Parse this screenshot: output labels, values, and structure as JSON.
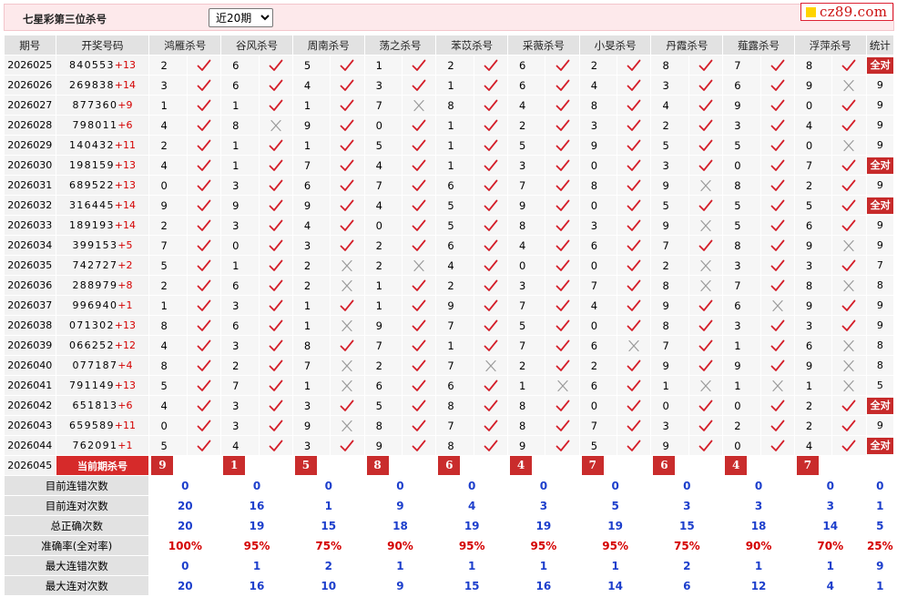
{
  "header": {
    "title": "七星彩第三位杀号",
    "period_select": "近20期",
    "logo_text": "cz89.com"
  },
  "columns": [
    "期号",
    "开奖号码",
    "鸿雁杀号",
    "谷风杀号",
    "周南杀号",
    "荡之杀号",
    "苯苡杀号",
    "采薇杀号",
    "小旻杀号",
    "丹霞杀号",
    "薤露杀号",
    "浮萍杀号",
    "统计"
  ],
  "rows": [
    {
      "period": "2026025",
      "digits": "840553",
      "extra": "+13",
      "kills": [
        "2",
        "6",
        "5",
        "1",
        "2",
        "6",
        "2",
        "8",
        "7",
        "8"
      ],
      "marks": [
        1,
        1,
        1,
        1,
        1,
        1,
        1,
        1,
        1,
        1
      ],
      "stat": "全对"
    },
    {
      "period": "2026026",
      "digits": "269838",
      "extra": "+14",
      "kills": [
        "3",
        "6",
        "4",
        "3",
        "1",
        "6",
        "4",
        "3",
        "6",
        "9"
      ],
      "marks": [
        1,
        1,
        1,
        1,
        1,
        1,
        1,
        1,
        1,
        0
      ],
      "stat": "9"
    },
    {
      "period": "2026027",
      "digits": "877360",
      "extra": "+9",
      "kills": [
        "1",
        "1",
        "1",
        "7",
        "8",
        "4",
        "8",
        "4",
        "9",
        "0"
      ],
      "marks": [
        1,
        1,
        1,
        0,
        1,
        1,
        1,
        1,
        1,
        1
      ],
      "stat": "9"
    },
    {
      "period": "2026028",
      "digits": "798011",
      "extra": "+6",
      "kills": [
        "4",
        "8",
        "9",
        "0",
        "1",
        "2",
        "3",
        "2",
        "3",
        "4"
      ],
      "marks": [
        1,
        0,
        1,
        1,
        1,
        1,
        1,
        1,
        1,
        1
      ],
      "stat": "9"
    },
    {
      "period": "2026029",
      "digits": "140432",
      "extra": "+11",
      "kills": [
        "2",
        "1",
        "1",
        "5",
        "1",
        "5",
        "9",
        "5",
        "5",
        "0"
      ],
      "marks": [
        1,
        1,
        1,
        1,
        1,
        1,
        1,
        1,
        1,
        0
      ],
      "stat": "9"
    },
    {
      "period": "2026030",
      "digits": "198159",
      "extra": "+13",
      "kills": [
        "4",
        "1",
        "7",
        "4",
        "1",
        "3",
        "0",
        "3",
        "0",
        "7"
      ],
      "marks": [
        1,
        1,
        1,
        1,
        1,
        1,
        1,
        1,
        1,
        1
      ],
      "stat": "全对"
    },
    {
      "period": "2026031",
      "digits": "689522",
      "extra": "+13",
      "kills": [
        "0",
        "3",
        "6",
        "7",
        "6",
        "7",
        "8",
        "9",
        "8",
        "2"
      ],
      "marks": [
        1,
        1,
        1,
        1,
        1,
        1,
        1,
        0,
        1,
        1
      ],
      "stat": "9"
    },
    {
      "period": "2026032",
      "digits": "316445",
      "extra": "+14",
      "kills": [
        "9",
        "9",
        "9",
        "4",
        "5",
        "9",
        "0",
        "5",
        "5",
        "5"
      ],
      "marks": [
        1,
        1,
        1,
        1,
        1,
        1,
        1,
        1,
        1,
        1
      ],
      "stat": "全对"
    },
    {
      "period": "2026033",
      "digits": "189193",
      "extra": "+14",
      "kills": [
        "2",
        "3",
        "4",
        "0",
        "5",
        "8",
        "3",
        "9",
        "5",
        "6"
      ],
      "marks": [
        1,
        1,
        1,
        1,
        1,
        1,
        1,
        0,
        1,
        1
      ],
      "stat": "9"
    },
    {
      "period": "2026034",
      "digits": "399153",
      "extra": "+5",
      "kills": [
        "7",
        "0",
        "3",
        "2",
        "6",
        "4",
        "6",
        "7",
        "8",
        "9"
      ],
      "marks": [
        1,
        1,
        1,
        1,
        1,
        1,
        1,
        1,
        1,
        0
      ],
      "stat": "9"
    },
    {
      "period": "2026035",
      "digits": "742727",
      "extra": "+2",
      "kills": [
        "5",
        "1",
        "2",
        "2",
        "4",
        "0",
        "0",
        "2",
        "3",
        "3"
      ],
      "marks": [
        1,
        1,
        0,
        0,
        1,
        1,
        1,
        0,
        1,
        1
      ],
      "stat": "7"
    },
    {
      "period": "2026036",
      "digits": "288979",
      "extra": "+8",
      "kills": [
        "2",
        "6",
        "2",
        "1",
        "2",
        "3",
        "7",
        "8",
        "7",
        "8"
      ],
      "marks": [
        1,
        1,
        0,
        1,
        1,
        1,
        1,
        0,
        1,
        0
      ],
      "stat": "8"
    },
    {
      "period": "2026037",
      "digits": "996940",
      "extra": "+1",
      "kills": [
        "1",
        "3",
        "1",
        "1",
        "9",
        "7",
        "4",
        "9",
        "6",
        "9"
      ],
      "marks": [
        1,
        1,
        1,
        1,
        1,
        1,
        1,
        1,
        0,
        1
      ],
      "stat": "9"
    },
    {
      "period": "2026038",
      "digits": "071302",
      "extra": "+13",
      "kills": [
        "8",
        "6",
        "1",
        "9",
        "7",
        "5",
        "0",
        "8",
        "3",
        "3"
      ],
      "marks": [
        1,
        1,
        0,
        1,
        1,
        1,
        1,
        1,
        1,
        1
      ],
      "stat": "9"
    },
    {
      "period": "2026039",
      "digits": "066252",
      "extra": "+12",
      "kills": [
        "4",
        "3",
        "8",
        "7",
        "1",
        "7",
        "6",
        "7",
        "1",
        "6"
      ],
      "marks": [
        1,
        1,
        1,
        1,
        1,
        1,
        0,
        1,
        1,
        0
      ],
      "stat": "8"
    },
    {
      "period": "2026040",
      "digits": "077187",
      "extra": "+4",
      "kills": [
        "8",
        "2",
        "7",
        "2",
        "7",
        "2",
        "2",
        "9",
        "9",
        "9"
      ],
      "marks": [
        1,
        1,
        0,
        1,
        0,
        1,
        1,
        1,
        1,
        0
      ],
      "stat": "8"
    },
    {
      "period": "2026041",
      "digits": "791149",
      "extra": "+13",
      "kills": [
        "5",
        "7",
        "1",
        "6",
        "6",
        "1",
        "6",
        "1",
        "1",
        "1"
      ],
      "marks": [
        1,
        1,
        0,
        1,
        1,
        0,
        1,
        0,
        0,
        0
      ],
      "stat": "5"
    },
    {
      "period": "2026042",
      "digits": "651813",
      "extra": "+6",
      "kills": [
        "4",
        "3",
        "3",
        "5",
        "8",
        "8",
        "0",
        "0",
        "0",
        "2"
      ],
      "marks": [
        1,
        1,
        1,
        1,
        1,
        1,
        1,
        1,
        1,
        1
      ],
      "stat": "全对"
    },
    {
      "period": "2026043",
      "digits": "659589",
      "extra": "+11",
      "kills": [
        "0",
        "3",
        "9",
        "8",
        "7",
        "8",
        "7",
        "3",
        "2",
        "2"
      ],
      "marks": [
        1,
        1,
        0,
        1,
        1,
        1,
        1,
        1,
        1,
        1
      ],
      "stat": "9"
    },
    {
      "period": "2026044",
      "digits": "762091",
      "extra": "+1",
      "kills": [
        "5",
        "4",
        "3",
        "9",
        "8",
        "9",
        "5",
        "9",
        "0",
        "4"
      ],
      "marks": [
        1,
        1,
        1,
        1,
        1,
        1,
        1,
        1,
        1,
        1
      ],
      "stat": "全对"
    }
  ],
  "current": {
    "period": "2026045",
    "label": "当前期杀号",
    "kills": [
      "9",
      "1",
      "5",
      "8",
      "6",
      "4",
      "7",
      "6",
      "4",
      "7"
    ]
  },
  "stats": [
    {
      "label": "目前连错次数",
      "values": [
        "0",
        "0",
        "0",
        "0",
        "0",
        "0",
        "0",
        "0",
        "0",
        "0",
        "0"
      ]
    },
    {
      "label": "目前连对次数",
      "values": [
        "20",
        "16",
        "1",
        "9",
        "4",
        "3",
        "5",
        "3",
        "3",
        "3",
        "1"
      ]
    },
    {
      "label": "总正确次数",
      "values": [
        "20",
        "19",
        "15",
        "18",
        "19",
        "19",
        "19",
        "15",
        "18",
        "14",
        "5"
      ]
    },
    {
      "label": "准确率(全对率)",
      "values": [
        "100%",
        "95%",
        "75%",
        "90%",
        "95%",
        "95%",
        "95%",
        "75%",
        "90%",
        "70%",
        "25%"
      ],
      "red": true
    },
    {
      "label": "最大连错次数",
      "values": [
        "0",
        "1",
        "2",
        "1",
        "1",
        "1",
        "1",
        "2",
        "1",
        "1",
        "9"
      ]
    },
    {
      "label": "最大连对次数",
      "values": [
        "20",
        "16",
        "10",
        "9",
        "15",
        "16",
        "14",
        "6",
        "12",
        "4",
        "1"
      ]
    }
  ],
  "colors": {
    "check": "#d41f2a",
    "cross": "#9a9a9a",
    "badge": "#c72a2a",
    "stat_blue": "#1d3fcc",
    "stat_red": "#d40000",
    "header_bg": "#fde9eb"
  }
}
